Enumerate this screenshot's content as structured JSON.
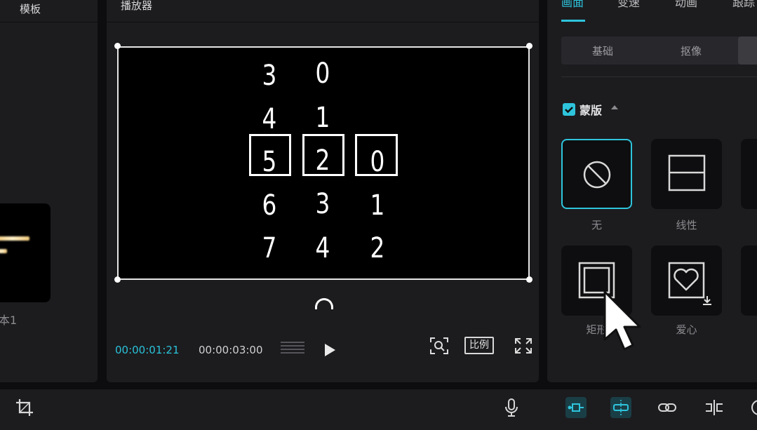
{
  "left_panel": {
    "title": "模板",
    "template_name": "本1"
  },
  "player": {
    "title": "播放器",
    "time_current": "00:00:01:21",
    "time_total": "00:00:03:00",
    "ratio_label": "比例",
    "digits": {
      "column_1": [
        "3",
        "4",
        "5",
        "6",
        "7"
      ],
      "column_2": [
        "0",
        "1",
        "2",
        "3",
        "4"
      ],
      "column_3": [
        "0",
        "1",
        "2"
      ]
    }
  },
  "right_panel": {
    "tabs": [
      {
        "label": "画面",
        "active": true
      },
      {
        "label": "变速",
        "active": false
      },
      {
        "label": "动画",
        "active": false
      },
      {
        "label": "跟踪",
        "active": false
      }
    ],
    "subtabs": [
      "基础",
      "抠像"
    ],
    "mask_section": {
      "label": "蒙版",
      "checked": true
    },
    "masks": [
      {
        "name": "无",
        "icon": "no-mask-icon",
        "selected": true
      },
      {
        "name": "线性",
        "icon": "linear-mask-icon",
        "selected": false
      },
      {
        "name": "矩形",
        "icon": "rectangle-mask-icon",
        "selected": false
      },
      {
        "name": "爱心",
        "icon": "heart-mask-icon",
        "selected": false,
        "download": true
      }
    ]
  },
  "colors": {
    "accent": "#2ec4dc",
    "panel": "#1c1c1f",
    "background": "#0d0d0f"
  }
}
